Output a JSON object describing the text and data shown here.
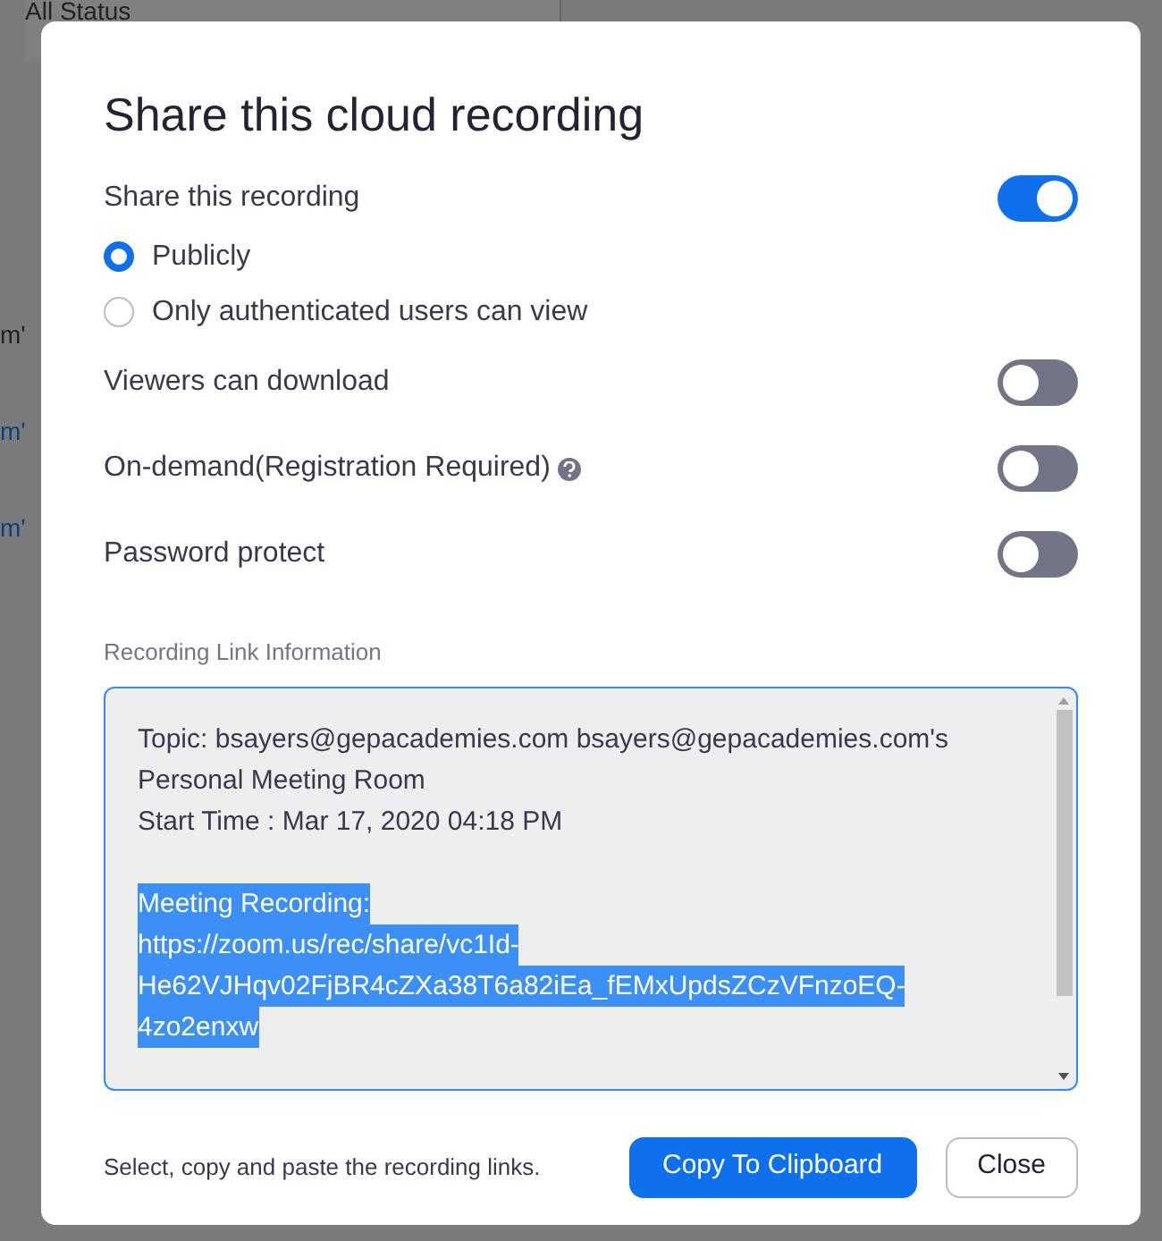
{
  "background": {
    "filter": {
      "value": "All Status"
    },
    "row_fragments": [
      {
        "text": "m'",
        "link": false
      },
      {
        "text": "m'",
        "link": true
      },
      {
        "text": "m'",
        "link": true
      }
    ]
  },
  "dialog": {
    "title": "Share this cloud recording",
    "settings": [
      {
        "kind": "toggle",
        "label": "Share this recording",
        "on": true
      },
      {
        "kind": "radio",
        "label": "Publicly",
        "selected": true
      },
      {
        "kind": "radio",
        "label": "Only authenticated users can view",
        "selected": false
      },
      {
        "kind": "toggle",
        "label": "Viewers can download",
        "on": false
      },
      {
        "kind": "toggle",
        "label": "On-demand(Registration Required)",
        "on": false,
        "help": true
      },
      {
        "kind": "toggle",
        "label": "Password protect",
        "on": false
      }
    ],
    "link_info": {
      "label": "Recording Link Information",
      "paragraphs": [
        {
          "selected": false,
          "lines": [
            "Topic: bsayers@gepacademies.com bsayers@gepacademies.com's",
            "Personal Meeting Room",
            "Start Time : Mar 17, 2020 04:18 PM"
          ]
        },
        {
          "selected": true,
          "lines": [
            "Meeting Recording:",
            "https://zoom.us/rec/share/vc1Id-",
            "He62VJHqv02FjBR4cZXa38T6a82iEa_fEMxUpdsZCzVFnzoEQ-",
            "4zo2enxw"
          ]
        }
      ]
    },
    "footer": {
      "hint": "Select, copy and paste the recording links.",
      "buttons": [
        {
          "label": "Copy To Clipboard",
          "primary": true
        },
        {
          "label": "Close",
          "primary": false
        }
      ]
    }
  }
}
